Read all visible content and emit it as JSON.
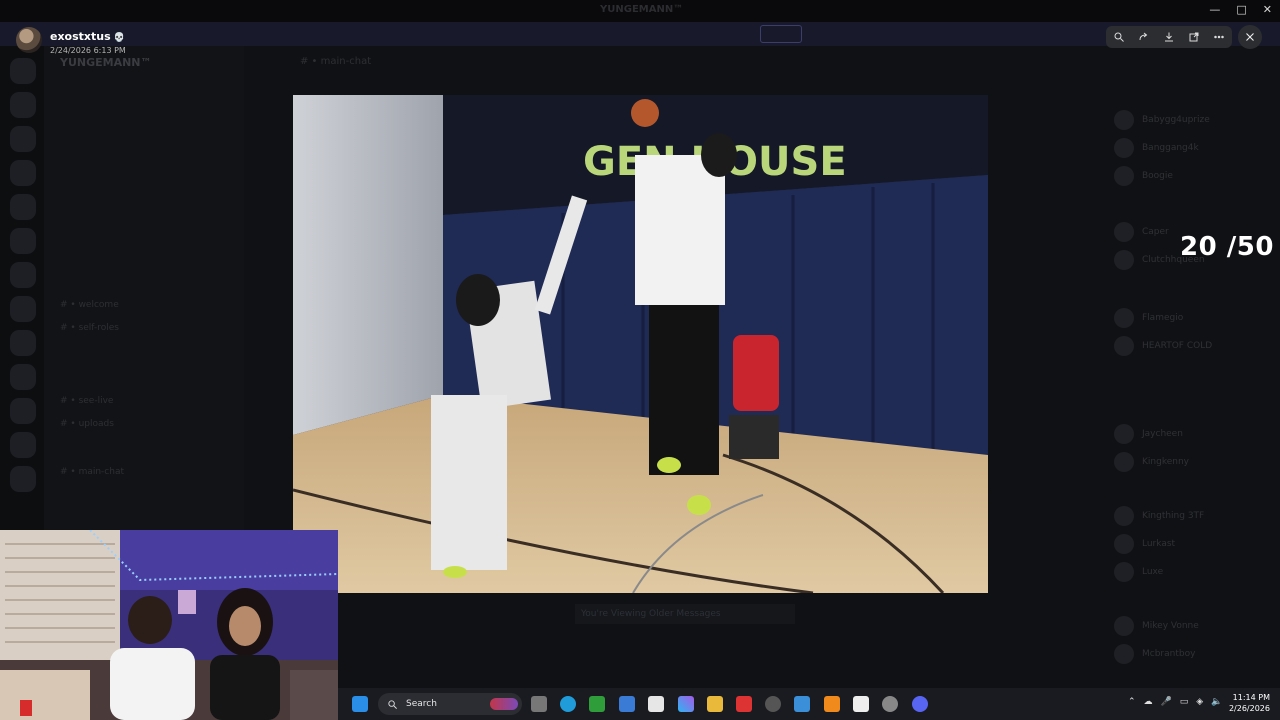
{
  "window": {
    "title": "YUNGEMANN™"
  },
  "background": {
    "server_name": "YUNGEMANN™",
    "channel_header": "# • main-chat",
    "channels": [
      "# • welcome",
      "# • self-roles",
      "# • see-live",
      "# • uploads",
      "# • main-chat"
    ],
    "members": [
      "Babygg4uprize",
      "Banggang4k",
      "Boogie",
      "Caper",
      "Clutchhqueen",
      "Flamegio",
      "HEARTOF COLD",
      "Jaycheen",
      "Kingkenny",
      "Kingthing 3TF",
      "Lurkast",
      "Luxe",
      "Mikey Vonne",
      "Mcbrantboy"
    ],
    "bottom_bar_text": "You're Viewing Older Messages"
  },
  "lightbox": {
    "uploader": {
      "name": "exostxtus",
      "badge": "💀",
      "timestamp": "2/24/2026 6:13 PM"
    },
    "toolbar": [
      "zoom-icon",
      "forward-icon",
      "download-icon",
      "open-external-icon",
      "more-icon"
    ],
    "close_icon": "close-icon",
    "media_text": "GEN HOUSE"
  },
  "overlay": {
    "counter": "20 /50"
  },
  "taskbar": {
    "search_placeholder": "Search",
    "time": "11:14 PM",
    "date": "2/26/2026",
    "accent_color": "#5865f2"
  }
}
